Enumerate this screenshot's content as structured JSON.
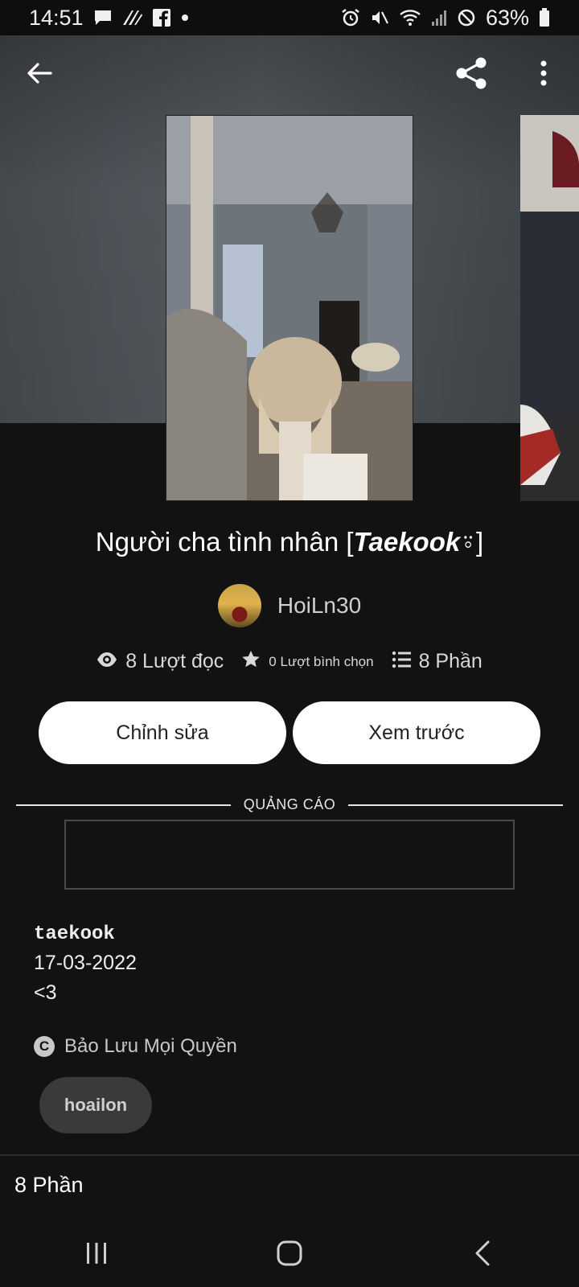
{
  "status_bar": {
    "time": "14:51",
    "battery": "63%",
    "left_icons": [
      "message-icon",
      "wattpad-notification-icon",
      "facebook-icon",
      "dot-icon"
    ],
    "right_icons": [
      "alarm-icon",
      "mute-icon",
      "wifi-icon",
      "signal-icon",
      "block-icon",
      "battery-icon"
    ]
  },
  "top_bar": {
    "back_icon": "arrow-left-icon",
    "share_icon": "share-icon",
    "more_icon": "more-vertical-icon"
  },
  "story": {
    "title_plain": "Người cha tình nhân [",
    "title_bold": "Taekook",
    "title_end": "⍤]",
    "author": "HoiLn30",
    "stats": {
      "reads": "8 Lượt đọc",
      "votes": "0 Lượt bình chọn",
      "parts": "8 Phần"
    }
  },
  "actions": {
    "edit_label": "Chỉnh sửa",
    "preview_label": "Xem trước"
  },
  "ad": {
    "label": "QUẢNG CÁO"
  },
  "description": {
    "line1": "taekook",
    "line2": "17-03-2022",
    "line3": "<3"
  },
  "copyright": "Bảo Lưu Mọi Quyền",
  "tags": [
    "hoailon"
  ],
  "parts_section": {
    "heading": "8 Phần"
  },
  "colors": {
    "background": "#121212",
    "button_bg": "#ffffff",
    "tag_bg": "#3a3a3a"
  }
}
